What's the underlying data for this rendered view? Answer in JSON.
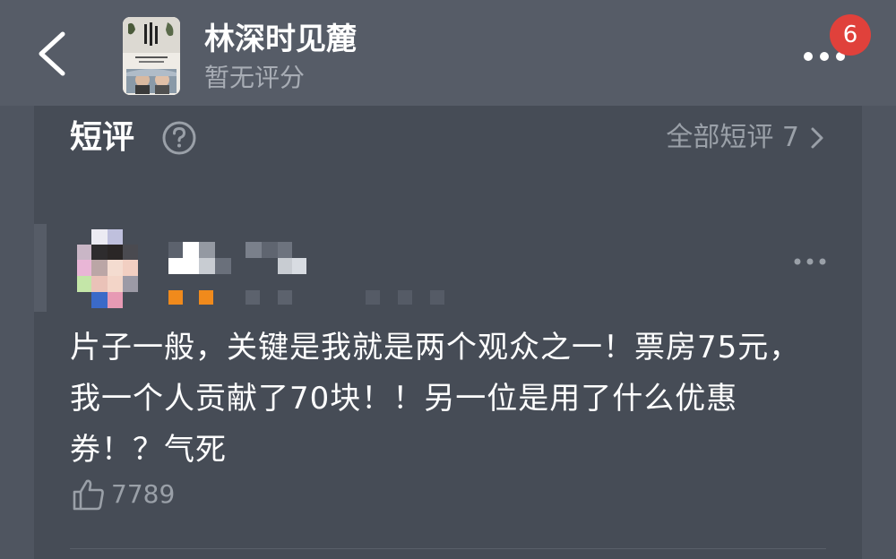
{
  "header": {
    "back_icon": "chevron-left-icon",
    "movie_title": "林深时见麓",
    "rating_text": "暂无评分",
    "more_icon": "more-dots-icon",
    "badge_count": "6"
  },
  "section": {
    "title": "短评",
    "help_icon": "question-circle-icon",
    "all_reviews_label": "全部短评 7",
    "all_reviews_icon": "chevron-right-icon"
  },
  "comment": {
    "text": "片子一般，关键是我就是两个观众之一！票房75元，我一个人贡献了70块！！另一位是用了什么优惠券！？气死",
    "like_icon": "thumbs-up-icon",
    "like_count": "7789",
    "more_icon": "more-dots-icon"
  },
  "colors": {
    "background": "#4f5560",
    "header": "#565c67",
    "card": "#464c56",
    "badge": "#e0413b",
    "muted_text": "#9aa0a8",
    "accent_orange": "#f08a1c"
  }
}
